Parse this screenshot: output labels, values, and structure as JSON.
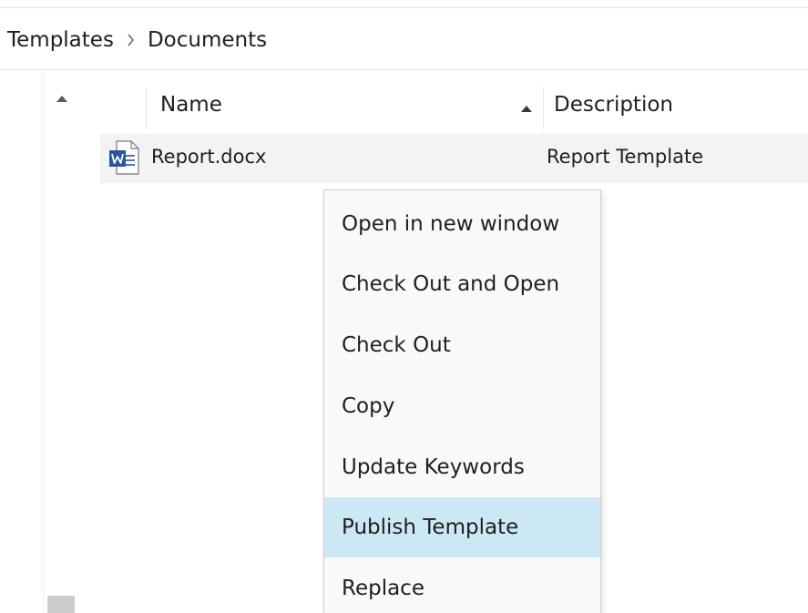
{
  "breadcrumb": {
    "items": [
      "Templates",
      "Documents"
    ],
    "separator_icon": "chevron-right-icon"
  },
  "columns": {
    "name": "Name",
    "description": "Description",
    "sort_icon": "sort-ascending-icon"
  },
  "file": {
    "name": "Report.docx",
    "description": "Report Template",
    "icon": "word-document-icon",
    "icon_color": "#2b579a"
  },
  "context_menu": {
    "items": [
      {
        "label": "Open in new window"
      },
      {
        "label": "Check Out and Open"
      },
      {
        "label": "Check Out"
      },
      {
        "label": "Copy"
      },
      {
        "label": "Update Keywords"
      },
      {
        "label": "Publish Template",
        "highlighted": true
      },
      {
        "label": "Replace"
      }
    ],
    "highlight_color": "#cce8f5"
  }
}
